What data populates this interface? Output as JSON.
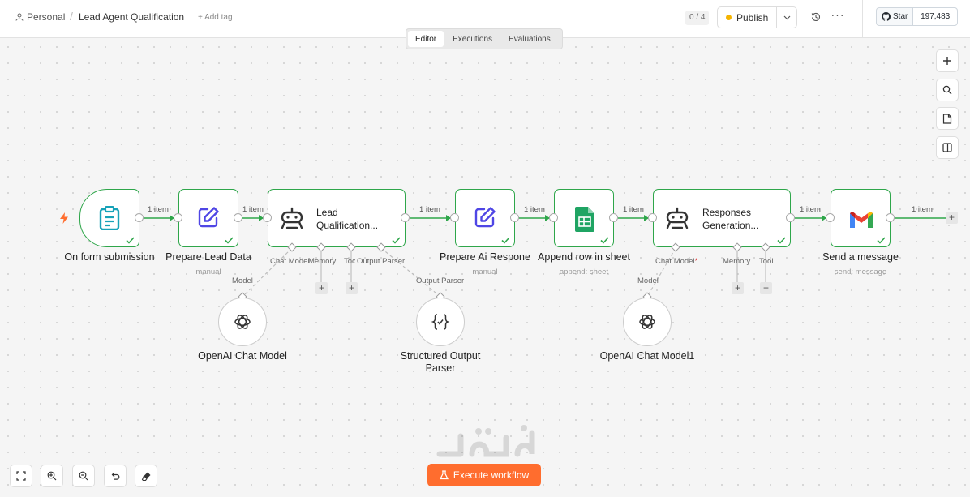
{
  "header": {
    "project": "Personal",
    "workflow_title": "Lead Agent Qualification",
    "add_tag": "+ Add tag",
    "counter": "0 / 4",
    "publish_label": "Publish",
    "github_star_label": "Star",
    "github_star_count": "197,483"
  },
  "tabs": [
    "Editor",
    "Executions",
    "Evaluations"
  ],
  "active_tab": "Editor",
  "nodes": {
    "form_trigger": {
      "title": "On form submission",
      "icon": "clipboard-icon"
    },
    "prepare_lead": {
      "title": "Prepare Lead Data",
      "subtitle": "manual",
      "icon": "edit-icon"
    },
    "lead_agent": {
      "title_line1": "Lead",
      "title_line2": "Qualification...",
      "icon": "robot-icon"
    },
    "prepare_ai": {
      "title": "Prepare Ai Respone",
      "subtitle": "manual",
      "icon": "edit-icon"
    },
    "append_row": {
      "title": "Append row in sheet",
      "subtitle": "append: sheet",
      "icon": "google-sheets-icon"
    },
    "responses_agent": {
      "title_line1": "Responses",
      "title_line2": "Generation...",
      "icon": "robot-icon"
    },
    "send_message": {
      "title": "Send a message",
      "subtitle": "send: message",
      "icon": "gmail-icon"
    }
  },
  "edge_labels": [
    "1 item",
    "1 item",
    "1 item",
    "1 item",
    "1 item",
    "1 item",
    "1 item"
  ],
  "ports": {
    "lead_agent": {
      "chat_model": "Chat Model",
      "memory": "Memory",
      "tool": "Tool",
      "output_parser": "Output Parser"
    },
    "responses_agent": {
      "chat_model": "Chat Model",
      "required_mark": "*",
      "memory": "Memory",
      "tool": "Tool"
    }
  },
  "sub_nodes": {
    "openai_model": {
      "port_label": "Model",
      "title": "OpenAI Chat Model",
      "icon": "openai-icon"
    },
    "output_parser": {
      "port_label": "Output Parser",
      "title_line1": "Structured Output",
      "title_line2": "Parser",
      "icon": "code-braces-icon"
    },
    "openai_model1": {
      "port_label": "Model",
      "title": "OpenAI Chat Model1",
      "icon": "openai-icon"
    }
  },
  "right_toolbar": [
    "plus-icon",
    "search-icon",
    "sticky-note-icon",
    "panel-icon"
  ],
  "bottom_controls": [
    "fit-view-icon",
    "zoom-in-icon",
    "zoom-out-icon",
    "undo-icon",
    "clear-icon"
  ],
  "execute_label": "Execute workflow",
  "colors": {
    "success": "#2ea64a",
    "accent": "#ff6d2e",
    "sheets": "#1fa463",
    "teal": "#17a2b8",
    "indigo": "#4f46e5"
  }
}
